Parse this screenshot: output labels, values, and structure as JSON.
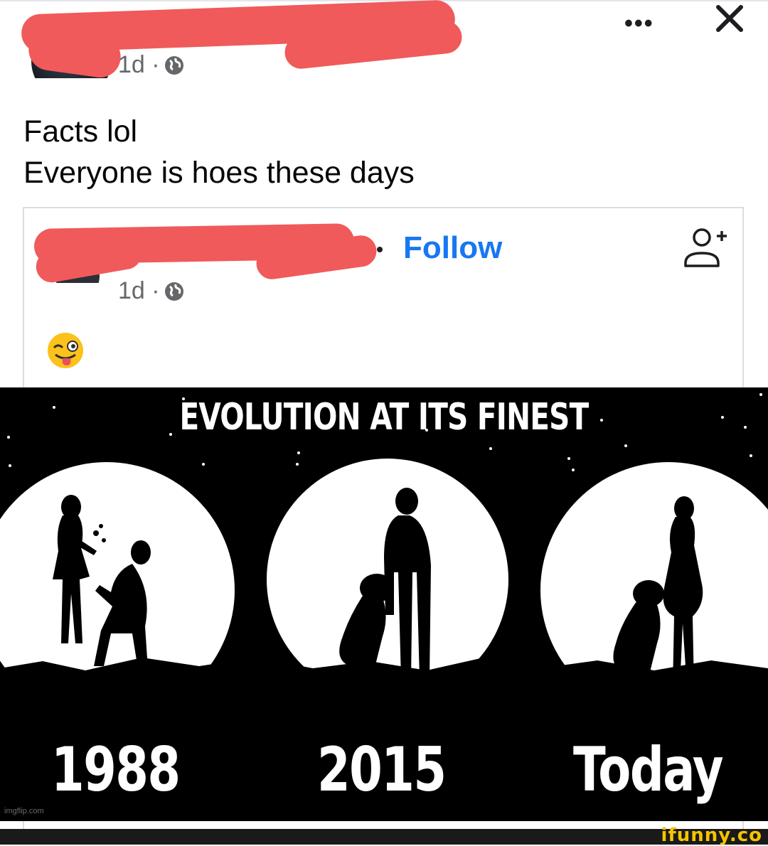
{
  "header": {
    "time": "1d ·",
    "more_label": "•••"
  },
  "post": {
    "line1": "Facts lol",
    "line2": "Everyone is hoes these days"
  },
  "shared": {
    "time": "1d ·",
    "follow_label": "Follow",
    "emoji": "winking-face-with-tongue"
  },
  "meme": {
    "title": "EVOLUTION AT ITS FINEST",
    "years": [
      "1988",
      "2015",
      "Today"
    ],
    "watermark": "imgflip.com"
  },
  "footer": {
    "watermark": "ifunny.co"
  },
  "colors": {
    "link": "#1877f2",
    "redaction": "#f05a5a",
    "meta": "#65676b"
  }
}
